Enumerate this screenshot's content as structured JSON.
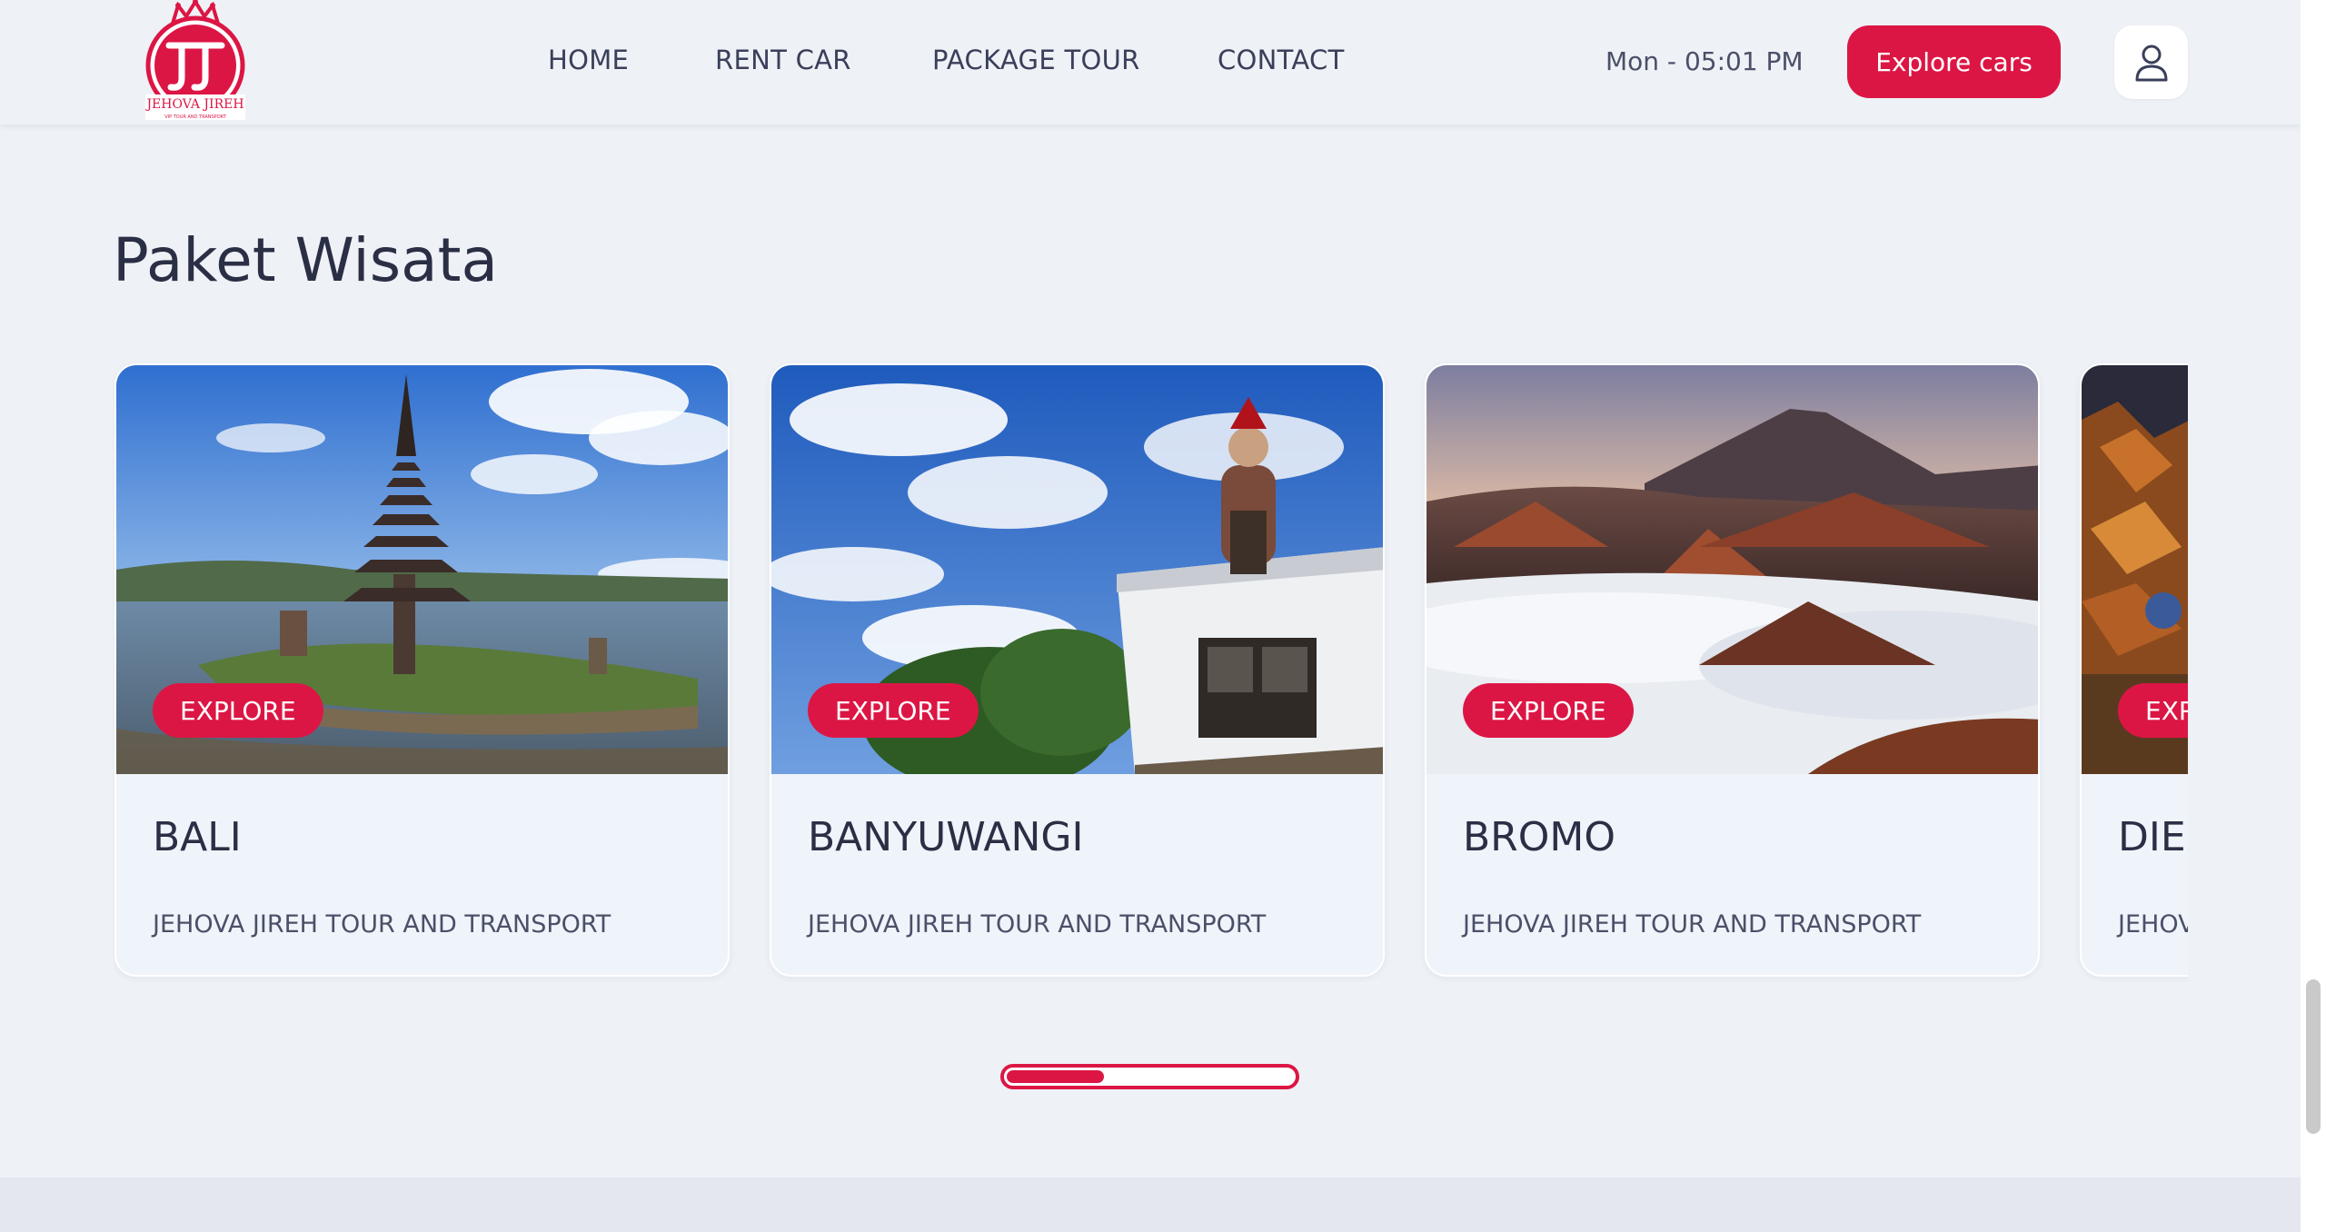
{
  "header": {
    "logo_text": "JEHOVA JIREH",
    "logo_tagline": "VIP TOUR AND TRANSPORT",
    "nav": [
      "HOME",
      "RENT CAR",
      "PACKAGE TOUR",
      "CONTACT"
    ],
    "datetime": "Mon - 05:01 PM",
    "cta_label": "Explore cars",
    "user_icon": "user-icon"
  },
  "section": {
    "title": "Paket Wisata"
  },
  "cards": [
    {
      "badge": "EXPLORE",
      "title": "BALI",
      "subtitle": "JEHOVA JIREH TOUR AND TRANSPORT"
    },
    {
      "badge": "EXPLORE",
      "title": "BANYUWANGI",
      "subtitle": "JEHOVA JIREH TOUR AND TRANSPORT"
    },
    {
      "badge": "EXPLORE",
      "title": "BROMO",
      "subtitle": "JEHOVA JIREH TOUR AND TRANSPORT"
    },
    {
      "badge": "EXPLORE",
      "title": "DIENG",
      "subtitle": "JEHOVA JIREH TOUR AND TRANSPORT"
    }
  ],
  "carousel": {
    "progress_fraction": 0.34
  },
  "colors": {
    "accent": "#dc1644",
    "background": "#eef1f6",
    "text": "#2b2f45"
  }
}
